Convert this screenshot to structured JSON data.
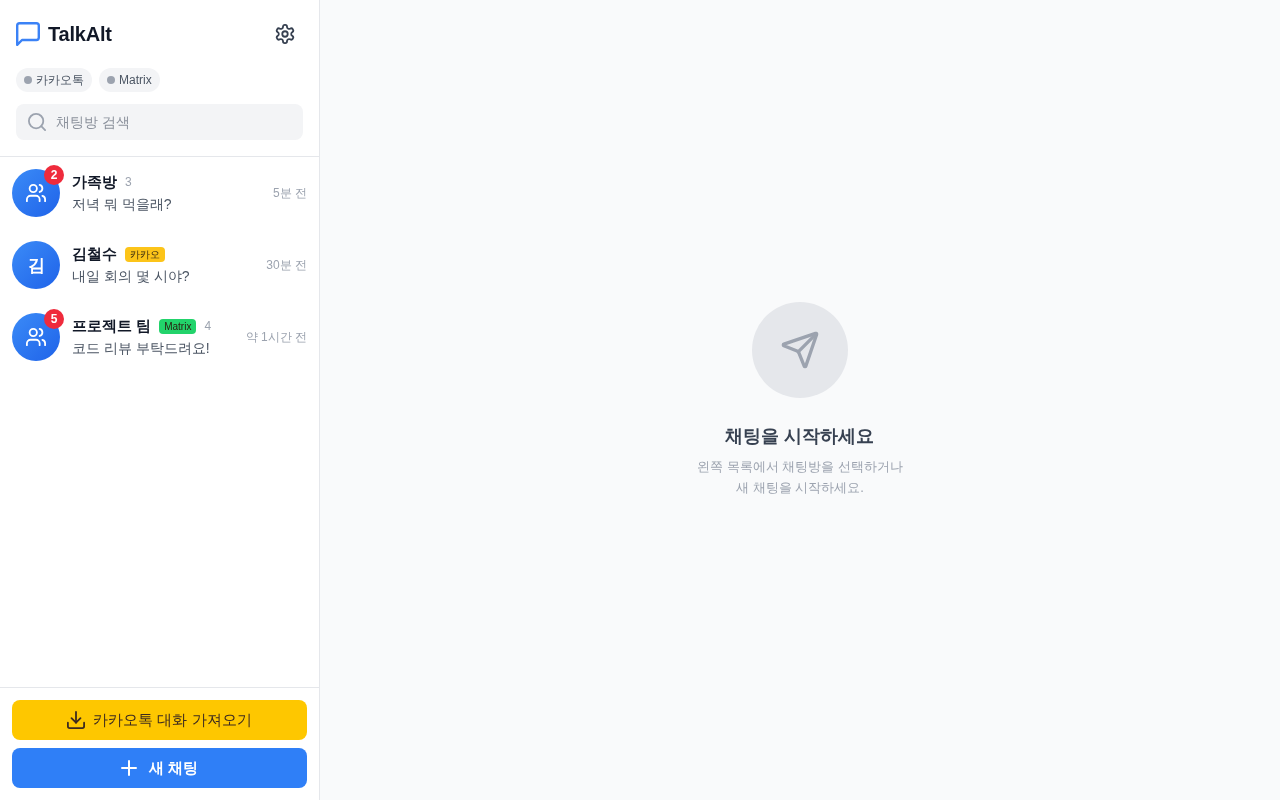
{
  "sidebar": {
    "app_title": "TalkAlt",
    "connections": [
      {
        "label": "카카오톡",
        "connected": false
      },
      {
        "label": "Matrix",
        "connected": false
      }
    ],
    "search": {
      "placeholder": "채팅방 검색"
    },
    "chats": [
      {
        "kind": "group",
        "name": "가족방",
        "member_count": "3",
        "last_message": "저녁 뭐 먹을래?",
        "time": "5분 전",
        "unread": "2"
      },
      {
        "kind": "direct",
        "avatar_text": "김",
        "name": "김철수",
        "tag": {
          "label": "카카오",
          "color": "#fcc419"
        },
        "last_message": "내일 회의 몇 시야?",
        "time": "30분 전"
      },
      {
        "kind": "group",
        "name": "프로젝트 팀",
        "tag": {
          "label": "Matrix",
          "color": "#22d36b"
        },
        "member_count": "4",
        "last_message": "코드 리뷰 부탁드려요!",
        "time": "약 1시간 전",
        "unread": "5"
      }
    ],
    "import_button": "카카오톡 대화 가져오기",
    "new_chat_button": "새 채팅"
  },
  "main": {
    "empty_state": {
      "title": "채팅을 시작하세요",
      "message": "왼쪽 목록에서 채팅방을 선택하거나 새 채팅을 시작하세요."
    }
  }
}
